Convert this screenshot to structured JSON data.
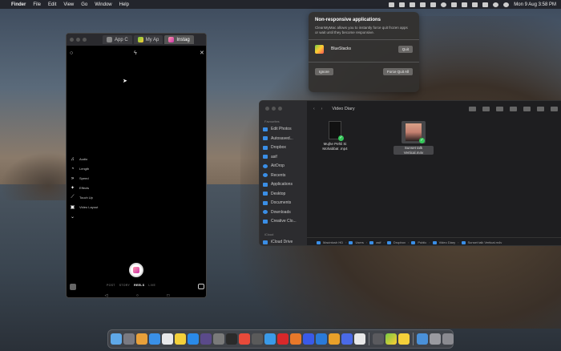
{
  "menubar": {
    "app": "Finder",
    "items": [
      "File",
      "Edit",
      "View",
      "Go",
      "Window",
      "Help"
    ],
    "clock": "Mon 9 Aug  3:58 PM"
  },
  "phone_window": {
    "tabs": [
      {
        "label": "App C",
        "icon": "app-icon"
      },
      {
        "label": "My Ap",
        "icon": "bluestacks-icon"
      },
      {
        "label": "Instag",
        "icon": "instagram-icon"
      }
    ],
    "side_options": [
      {
        "label": "Audio",
        "icon": "music-note-icon"
      },
      {
        "label": "Length",
        "icon": "timer-icon"
      },
      {
        "label": "Speed",
        "icon": "speed-icon"
      },
      {
        "label": "Effects",
        "icon": "sparkle-icon"
      },
      {
        "label": "Touch Up",
        "icon": "wand-icon"
      },
      {
        "label": "Video Layout",
        "icon": "layout-icon"
      }
    ],
    "modes": [
      "POST",
      "STORY",
      "REELS",
      "LIVE"
    ],
    "selected_mode": "REELS"
  },
  "notification": {
    "title": "Non-responsive applications",
    "body": "CleanMyMac allows you to instantly force quit frozen apps or wait until they become responsive.",
    "app_name": "BlueStacks",
    "quit_label": "Quit",
    "ignore_label": "Ignore",
    "force_quit_all_label": "Force Quit All"
  },
  "finder": {
    "title": "Video Diary",
    "sidebar_section": "Favourites",
    "sidebar_section2": "iCloud",
    "sidebar_items": [
      "Edit Photos",
      "Autosaved...",
      "Dropbox",
      "asif",
      "AirDrop",
      "Recents",
      "Applications",
      "Desktop",
      "Documents",
      "Downloads",
      "Creative Clo...",
      "iCloud Drive"
    ],
    "files": [
      {
        "name": "Mujhe Pehli Si Mohabbat .mp4",
        "selected": false
      },
      {
        "name": "Sunset talk Vertical.m4v",
        "selected": true
      }
    ],
    "path": [
      "Macintosh HD",
      "Users",
      "asif",
      "Dropbox",
      "Public",
      "Video Diary",
      "Sunset talk Vertical.m4v"
    ]
  }
}
